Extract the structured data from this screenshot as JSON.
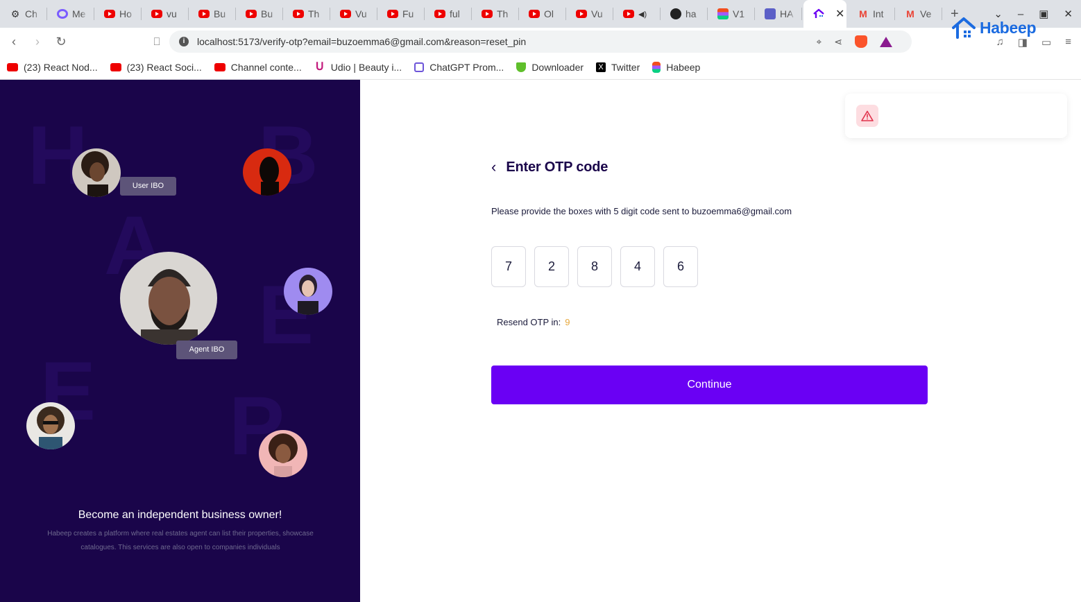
{
  "browser": {
    "tabs": [
      {
        "title": "Ch",
        "icon": "chatgpt-icon"
      },
      {
        "title": "Me",
        "icon": "meta-icon"
      },
      {
        "title": "Ho",
        "icon": "youtube-icon"
      },
      {
        "title": "vu",
        "icon": "youtube-icon"
      },
      {
        "title": "Bu",
        "icon": "youtube-icon"
      },
      {
        "title": "Bu",
        "icon": "youtube-icon"
      },
      {
        "title": "Th",
        "icon": "youtube-icon"
      },
      {
        "title": "Vu",
        "icon": "youtube-icon"
      },
      {
        "title": "Fu",
        "icon": "youtube-icon"
      },
      {
        "title": "ful",
        "icon": "youtube-icon"
      },
      {
        "title": "Th",
        "icon": "youtube-icon"
      },
      {
        "title": "Ol",
        "icon": "youtube-icon"
      },
      {
        "title": "Vu",
        "icon": "youtube-icon"
      },
      {
        "title": "",
        "icon": "youtube-icon"
      },
      {
        "title": "ha",
        "icon": "github-icon"
      },
      {
        "title": "V1",
        "icon": "figma-icon"
      },
      {
        "title": "HA",
        "icon": "docs-icon"
      },
      {
        "title": "",
        "icon": "habeep-icon",
        "active": true
      },
      {
        "title": "Int",
        "icon": "gmail-icon"
      },
      {
        "title": "Ve",
        "icon": "gmail-icon"
      }
    ],
    "url": "localhost:5173/verify-otp?email=buzoemma6@gmail.com&reason=reset_pin",
    "bookmarks": [
      {
        "label": "(23) React Nod...",
        "icon": "youtube-icon"
      },
      {
        "label": "(23) React Soci...",
        "icon": "youtube-icon"
      },
      {
        "label": "Channel conte...",
        "icon": "youtube-icon"
      },
      {
        "label": "Udio | Beauty i...",
        "icon": "udio-icon"
      },
      {
        "label": "ChatGPT Prom...",
        "icon": "cube-icon"
      },
      {
        "label": "Downloader",
        "icon": "download-icon"
      },
      {
        "label": "Twitter",
        "icon": "x-icon"
      },
      {
        "label": "Habeep",
        "icon": "figma-icon"
      }
    ]
  },
  "brand": {
    "name": "Habeep",
    "color": "#1b6be0"
  },
  "left": {
    "background_letters": [
      "H",
      "B",
      "A",
      "E",
      "E",
      "P"
    ],
    "chips": {
      "user": "User IBO",
      "agent": "Agent IBO"
    },
    "title": "Become an independent business owner!",
    "description": "Habeep creates a platform where real estates agent can list their properties, showcase catalogues. This services are also open to companies individuals",
    "colors": {
      "panel": "#1a054a"
    }
  },
  "form": {
    "title": "Enter OTP code",
    "instruction": "Please provide the boxes with 5 digit code sent to buzoemma6@gmail.com",
    "otp": [
      "7",
      "2",
      "8",
      "4",
      "6"
    ],
    "resend_label": "Resend OTP in:",
    "resend_count": "9",
    "continue_label": "Continue",
    "colors": {
      "primary": "#6a00f4",
      "countdown": "#e7a83c",
      "warning_bg": "#fddde1",
      "warning": "#e0314b"
    }
  }
}
